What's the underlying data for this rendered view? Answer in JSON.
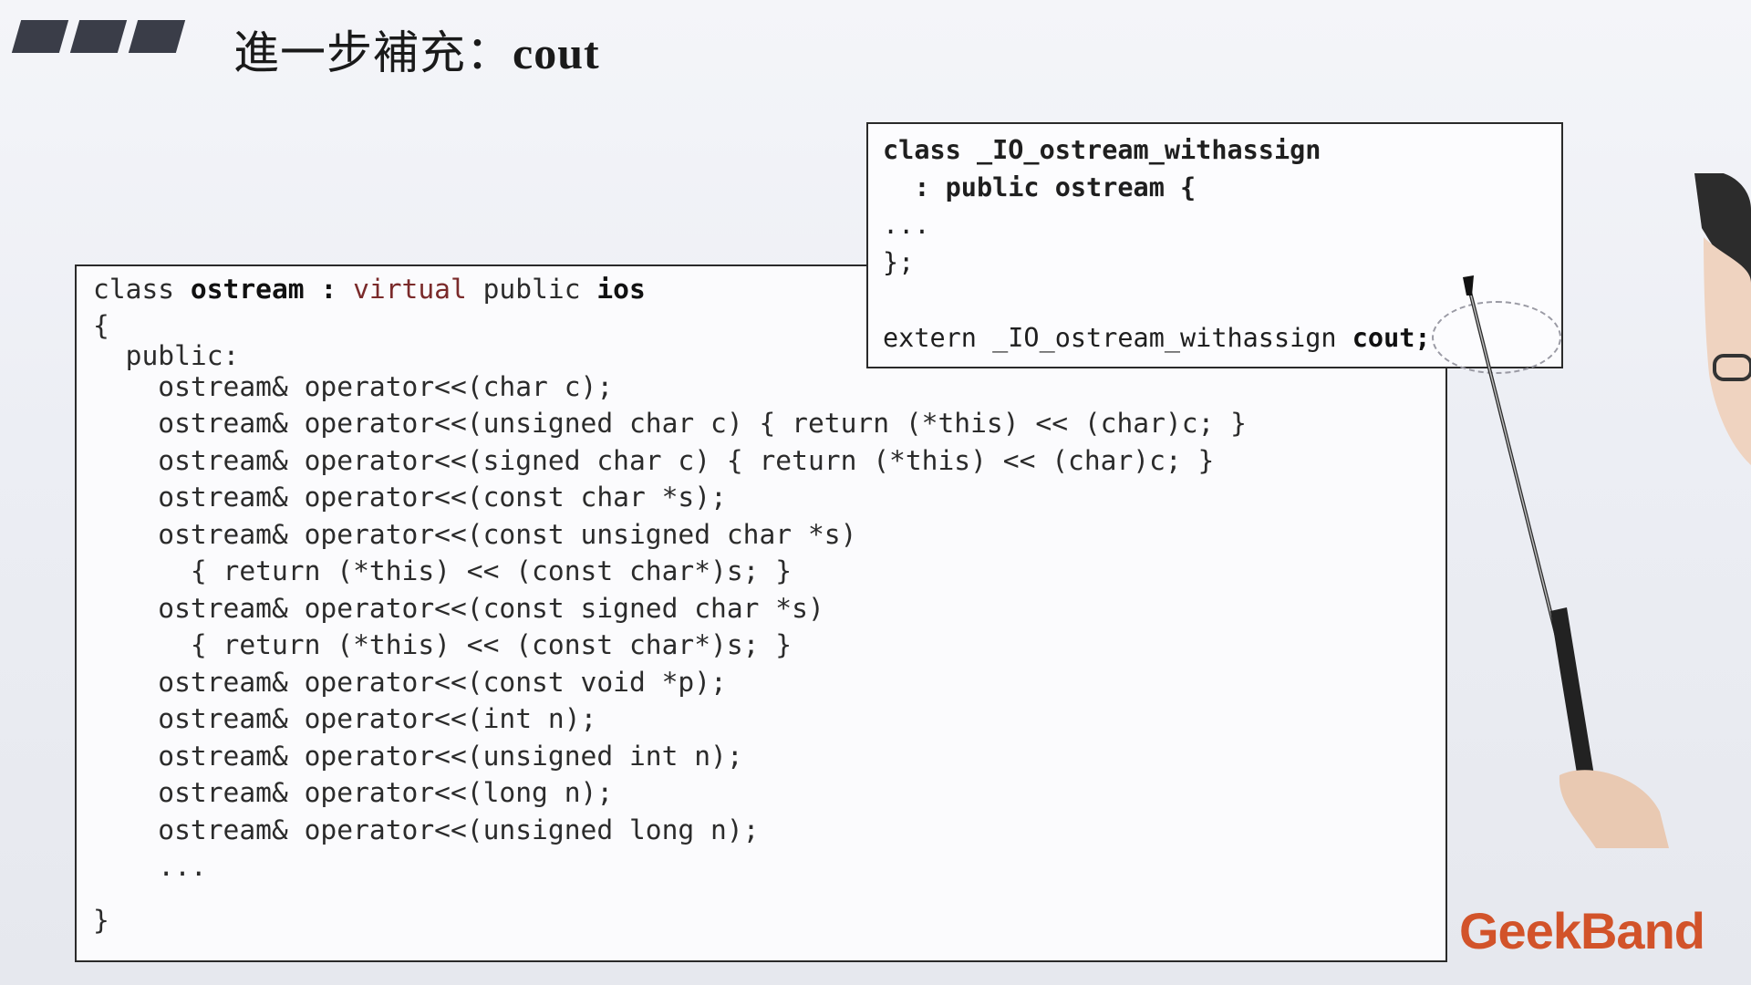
{
  "slide": {
    "title_prefix": "進一步補充：",
    "title_keyword": "cout"
  },
  "main_code": {
    "line1": {
      "kw_class": "class ",
      "name": "ostream",
      "colon": " : ",
      "kw_virtual": "virtual",
      "kw_public": " public ",
      "base": "ios"
    },
    "lines": [
      "{",
      "  public:",
      "    ostream& operator<<(char c);",
      "    ostream& operator<<(unsigned char c) { return (*this) << (char)c; }",
      "    ostream& operator<<(signed char c) { return (*this) << (char)c; }",
      "    ostream& operator<<(const char *s);",
      "    ostream& operator<<(const unsigned char *s)",
      "      { return (*this) << (const char*)s; }",
      "    ostream& operator<<(const signed char *s)",
      "      { return (*this) << (const char*)s; }",
      "    ostream& operator<<(const void *p);",
      "    ostream& operator<<(int n);",
      "    ostream& operator<<(unsigned int n);",
      "    ostream& operator<<(long n);",
      "    ostream& operator<<(unsigned long n);",
      "    ...",
      "}"
    ]
  },
  "side_code": {
    "line1": "class _IO_ostream_withassign",
    "line2": "  : public ostream {",
    "line3": "...",
    "line4": "};",
    "line5_prefix": "extern _IO_ostream_withassign ",
    "line5_highlight": "cout;"
  },
  "logo": {
    "text": "GeekBand",
    "color": "#d2532a"
  },
  "colors": {
    "code_text": "#2b2b2b",
    "virtual_keyword": "#7a2a2a",
    "box_border": "#2a2a2a"
  }
}
